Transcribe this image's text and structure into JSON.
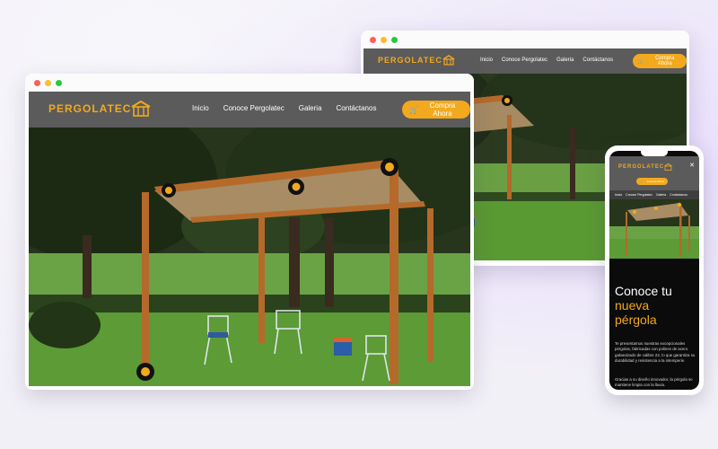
{
  "brand": {
    "name": "PERGOLATEC",
    "accent_color": "#f3a91d",
    "header_color": "#5b5b5c"
  },
  "nav": [
    "Inicio",
    "Conoce Pergolatec",
    "Galeria",
    "Contáctanos"
  ],
  "cta": {
    "label": "Compra Ahora",
    "icon": "cart-icon"
  },
  "window_dots": [
    "#ff5f57",
    "#febc2e",
    "#28c840"
  ],
  "phone": {
    "title_line1": "Conoce tu",
    "title_line2": "nueva",
    "title_line3": "pérgola",
    "paragraph1": "Te presentamos nuestras excepcionales pérgolas, fabricadas con polines de acero galvanizado de calibre 22, lo que garantiza su durabilidad y resistencia a la intemperie.",
    "paragraph2": "Gracias a su diseño innovador, la pérgola se mantiene limpia con la lluvia."
  }
}
